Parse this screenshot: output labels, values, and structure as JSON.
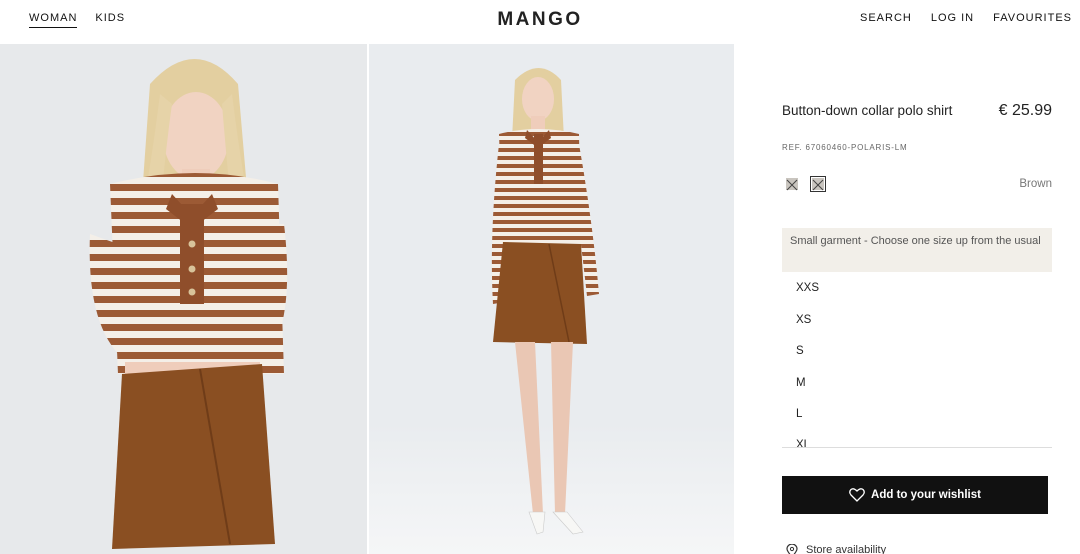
{
  "header": {
    "nav_left": [
      "WOMAN",
      "KIDS"
    ],
    "logo": "MANGO",
    "nav_right": [
      "SEARCH",
      "LOG IN",
      "FAVOURITES"
    ]
  },
  "product": {
    "title": "Button-down collar polo shirt",
    "price": "€ 25.99",
    "ref": "REF. 67060460-POLARIS-LM",
    "color_name": "Brown",
    "size_note": "Small garment - Choose one size up from the usual",
    "sizes": [
      "XXS",
      "XS",
      "S",
      "M",
      "L",
      "XL"
    ],
    "wishlist_label": "Add to your wishlist",
    "store_label": "Store availability"
  },
  "colors": {
    "skirt": "#8a4f22",
    "stripe": "#a0603a",
    "accent": "#111111"
  }
}
